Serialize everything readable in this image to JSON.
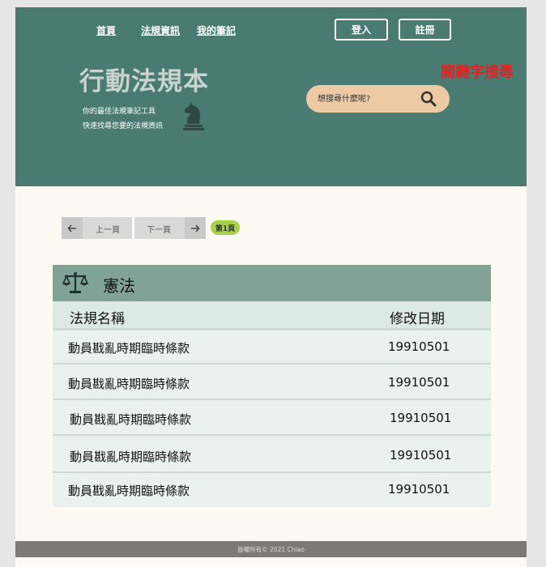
{
  "nav": {
    "home": "首頁",
    "law_info": "法規資訊",
    "my_notes": "我的筆記"
  },
  "auth": {
    "login": "登入",
    "register": "註冊"
  },
  "brand": {
    "title": "行動法規本",
    "tagline_1": "你的最佳法規筆記工具",
    "tagline_2": "快速找尋您要的法規資訊"
  },
  "search": {
    "placeholder": "想搜尋什麼呢?"
  },
  "annotation": {
    "text": "關鍵字搜尋"
  },
  "pager": {
    "prev": "上一頁",
    "next": "下一頁",
    "current": "第1頁"
  },
  "card": {
    "title": "憲法",
    "columns": {
      "name": "法規名稱",
      "date": "修改日期"
    },
    "rows": [
      {
        "name": "動員戡亂時期臨時條款",
        "date": "19910501"
      },
      {
        "name": "動員戡亂時期臨時條款",
        "date": "19910501"
      },
      {
        "name": "動員戡亂時期臨時條款",
        "date": "19910501"
      },
      {
        "name": "動員戡亂時期臨時條款",
        "date": "19910501"
      },
      {
        "name": "動員戡亂時期臨時條款",
        "date": "19910501"
      }
    ]
  },
  "footer": {
    "text": "版權所有© 2021 Chiao"
  },
  "colors": {
    "header": "#4a7b72",
    "search": "#edc9a4",
    "badge": "#a8d24a",
    "annotation": "#e32222"
  }
}
